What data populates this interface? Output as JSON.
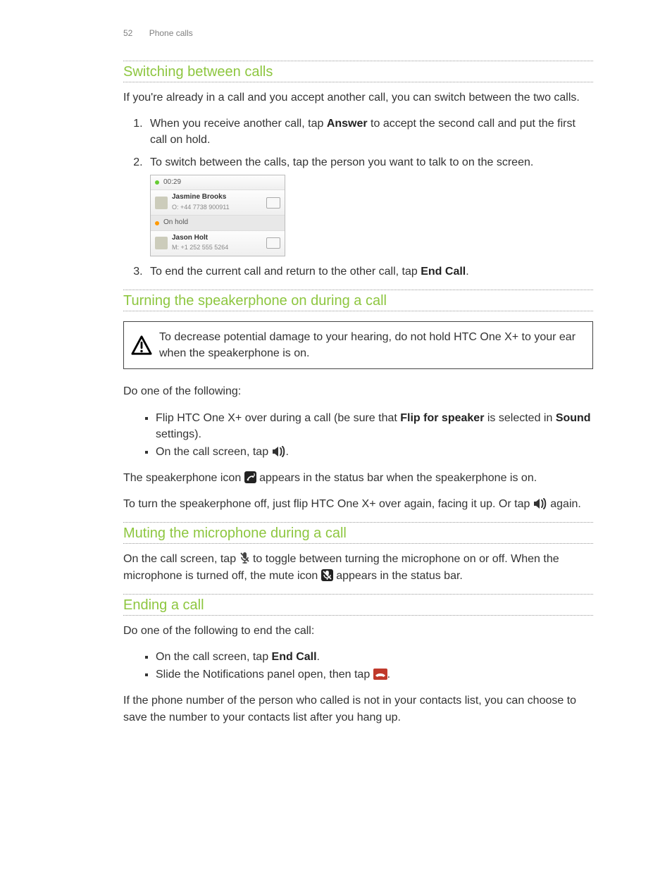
{
  "header": {
    "page_number": "52",
    "section": "Phone calls"
  },
  "s1": {
    "heading": "Switching between calls",
    "intro": "If you're already in a call and you accept another call, you can switch between the two calls.",
    "step1_a": "When you receive another call, tap ",
    "step1_b": "Answer",
    "step1_c": " to accept the second call and put the first call on hold.",
    "step2": "To switch between the calls, tap the person you want to talk to on the screen.",
    "step3_a": "To end the current call and return to the other call, tap ",
    "step3_b": "End Call",
    "step3_c": "."
  },
  "screenshot": {
    "timer": "00:29",
    "contact1_name": "Jasmine Brooks",
    "contact1_number": "O: +44 7738 900911",
    "onhold_label": "On hold",
    "contact2_name": "Jason Holt",
    "contact2_number": "M: +1 252 555 5264"
  },
  "s2": {
    "heading": "Turning the speakerphone on during a call",
    "warning": "To decrease potential damage to your hearing, do not hold HTC One X+ to your ear when the speakerphone is on.",
    "lead": "Do one of the following:",
    "bullet1_a": "Flip HTC One X+ over during a call (be sure that ",
    "bullet1_b": "Flip for speaker",
    "bullet1_c": " is selected in ",
    "bullet1_d": "Sound",
    "bullet1_e": " settings).",
    "bullet2_a": "On the call screen, tap ",
    "bullet2_b": ".",
    "para1_a": "The speakerphone icon ",
    "para1_b": " appears in the status bar when the speakerphone is on.",
    "para2_a": "To turn the speakerphone off, just flip HTC One X+ over again, facing it up. Or tap ",
    "para2_b": " again."
  },
  "s3": {
    "heading": "Muting the microphone during a call",
    "para_a": "On the call screen, tap ",
    "para_b": " to toggle between turning the microphone on or off. When the microphone is turned off, the mute icon ",
    "para_c": " appears in the status bar."
  },
  "s4": {
    "heading": "Ending a call",
    "lead": "Do one of the following to end the call:",
    "bullet1_a": "On the call screen, tap ",
    "bullet1_b": "End Call",
    "bullet1_c": ".",
    "bullet2_a": "Slide the Notifications panel open, then tap ",
    "bullet2_b": ".",
    "outro": "If the phone number of the person who called is not in your contacts list, you can choose to save the number to your contacts list after you hang up."
  }
}
